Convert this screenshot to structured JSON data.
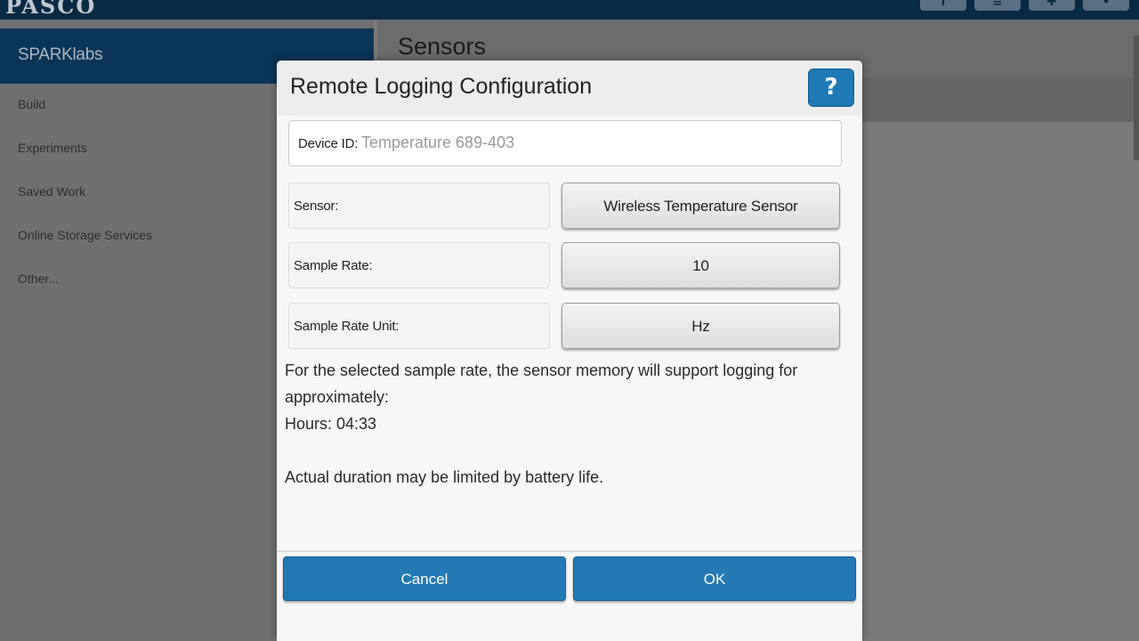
{
  "topbar": {
    "logo_text": "PASCO",
    "buttons": [
      {
        "icon": "info-icon",
        "glyph": "i"
      },
      {
        "icon": "menu-icon",
        "glyph": "≡"
      },
      {
        "icon": "settings-icon",
        "glyph": "✚"
      },
      {
        "icon": "user-icon",
        "glyph": "•"
      }
    ]
  },
  "sidebar": {
    "title": "SPARKlabs",
    "items": [
      {
        "label": "Build"
      },
      {
        "label": "Experiments"
      },
      {
        "label": "Saved Work"
      },
      {
        "label": "Online Storage Services"
      },
      {
        "label": "Other..."
      }
    ]
  },
  "main": {
    "title": "Sensors"
  },
  "dialog": {
    "title": "Remote Logging Configuration",
    "help_label": "?",
    "device_id": {
      "label": "Device ID:",
      "value": "Temperature 689-403"
    },
    "rows": [
      {
        "label": "Sensor:",
        "value": "Wireless Temperature Sensor"
      },
      {
        "label": "Sample Rate:",
        "value": "10"
      },
      {
        "label": "Sample Rate Unit:",
        "value": "Hz"
      }
    ],
    "info_line1": "For the selected sample rate, the sensor memory will support logging for",
    "info_line2": "approximately:",
    "hours": "Hours: 04:33",
    "battery_note": "Actual duration may be limited by battery life.",
    "cancel_label": "Cancel",
    "ok_label": "OK"
  },
  "colors": {
    "accent": "#2379b4",
    "topbar": "#082a45",
    "sidebar_header": "#0b3558"
  }
}
